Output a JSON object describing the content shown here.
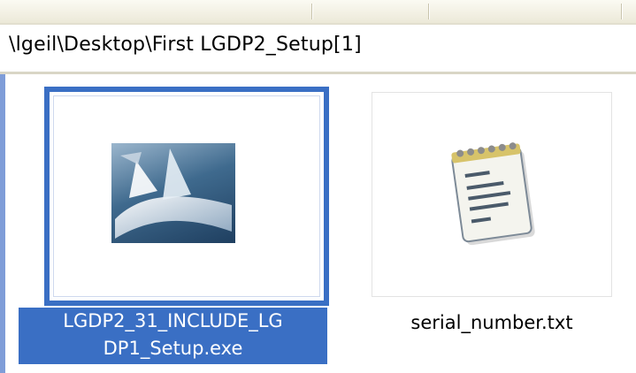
{
  "address_bar": {
    "path": "\\lgeil\\Desktop\\First LGDP2_Setup[1]"
  },
  "files": [
    {
      "name_line1": "LGDP2_31_INCLUDE_LG",
      "name_line2": "DP1_Setup.exe",
      "icon": "setup-installer-icon",
      "selected": true
    },
    {
      "name": "serial_number.txt",
      "icon": "notepad-text-file-icon",
      "selected": false
    }
  ],
  "colors": {
    "selection": "#3a6fc4",
    "toolbar": "#ece9d8"
  }
}
